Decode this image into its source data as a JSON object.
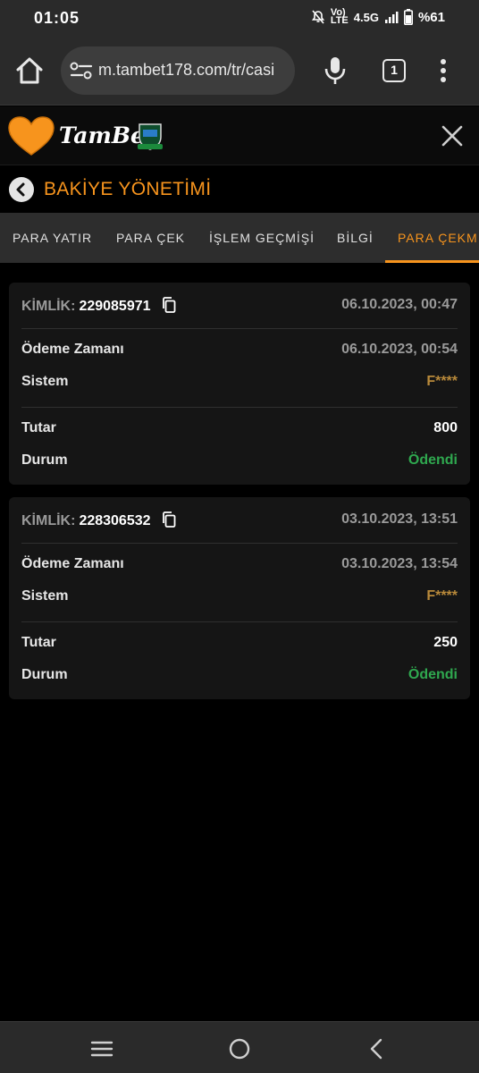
{
  "status_bar": {
    "time": "01:05",
    "network_top": "Vo)",
    "network_bottom": "LTE",
    "network_type": "4.5G",
    "battery": "%61"
  },
  "browser": {
    "url": "m.tambet178.com/tr/casi",
    "tab_count": "1"
  },
  "site": {
    "logo_text": "TamBet"
  },
  "page": {
    "title": "BAKİYE YÖNETİMİ"
  },
  "tabs": [
    {
      "label": "PARA YATIR",
      "active": false
    },
    {
      "label": "PARA ÇEK",
      "active": false
    },
    {
      "label": "İŞLEM GEÇMİŞİ",
      "active": false
    },
    {
      "label": "BİLGİ",
      "active": false
    },
    {
      "label": "PARA ÇEKM",
      "active": true
    }
  ],
  "transactions": [
    {
      "kimlik_label": "KİMLİK:",
      "id": "229085971",
      "created": "06.10.2023, 00:47",
      "odeme_zamani_label": "Ödeme Zamanı",
      "odeme_zamani": "06.10.2023, 00:54",
      "sistem_label": "Sistem",
      "sistem": "F****",
      "tutar_label": "Tutar",
      "tutar": "800",
      "durum_label": "Durum",
      "durum": "Ödendi"
    },
    {
      "kimlik_label": "KİMLİK:",
      "id": "228306532",
      "created": "03.10.2023, 13:51",
      "odeme_zamani_label": "Ödeme Zamanı",
      "odeme_zamani": "03.10.2023, 13:54",
      "sistem_label": "Sistem",
      "sistem": "F****",
      "tutar_label": "Tutar",
      "tutar": "250",
      "durum_label": "Durum",
      "durum": "Ödendi"
    }
  ],
  "colors": {
    "accent": "#f7941d",
    "paid": "#2fa84f",
    "sistem": "#b8893a"
  }
}
